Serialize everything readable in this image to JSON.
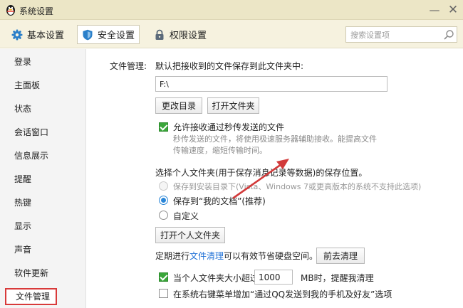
{
  "window": {
    "title": "系统设置",
    "minimize_glyph": "—",
    "close_glyph": "✕"
  },
  "tabs": [
    {
      "label": "基本设置",
      "icon": "gear-icon"
    },
    {
      "label": "安全设置",
      "icon": "shield-icon"
    },
    {
      "label": "权限设置",
      "icon": "lock-icon"
    }
  ],
  "search": {
    "placeholder": "搜索设置项"
  },
  "sidebar": {
    "items": [
      {
        "label": "登录"
      },
      {
        "label": "主面板"
      },
      {
        "label": "状态"
      },
      {
        "label": "会话窗口"
      },
      {
        "label": "信息展示"
      },
      {
        "label": "提醒"
      },
      {
        "label": "热键"
      },
      {
        "label": "显示"
      },
      {
        "label": "声音"
      },
      {
        "label": "软件更新"
      },
      {
        "label": "文件管理"
      }
    ],
    "active": "文件管理"
  },
  "file_manage": {
    "section_label": "文件管理:",
    "desc": "默认把接收到的文件保存到此文件夹中:",
    "path_value": "F:\\",
    "change_dir_button": "更改目录",
    "open_folder_button": "打开文件夹",
    "instant_transfer": {
      "label": "允许接收通过秒传发送的文件",
      "checked": true,
      "hint": "秒传发送的文件，将使用极速服务器辅助接收。能提高文件传输速度，缩短传输时间。"
    },
    "personal_folder": {
      "label": "选择个人文件夹(用于保存消息记录等数据)的保存位置。",
      "options": [
        {
          "label": "保存到安装目录下(Vista、Windows 7或更高版本的系统不支持此选项)",
          "disabled": true,
          "selected": false
        },
        {
          "label": "保存到“我的文档”(推荐)",
          "disabled": false,
          "selected": true
        },
        {
          "label": "自定义",
          "disabled": false,
          "selected": false
        }
      ],
      "open_button": "打开个人文件夹"
    },
    "cleanup": {
      "prefix": "定期进行",
      "link": "文件清理",
      "suffix": "可以有效节省硬盘空间。",
      "button": "前去清理"
    },
    "size_reminder": {
      "label_before": "当个人文件夹大小超过",
      "value": "1000",
      "label_after": "MB时，提醒我清理",
      "checked": true
    },
    "context_menu": {
      "label": "在系统右键菜单增加“通过QQ发送到我的手机及好友”选项",
      "checked": false
    }
  },
  "colors": {
    "titlebar_bg": "#ece6c6",
    "tabbar_bg": "#f6f2df",
    "accent_blue": "#2a86d8",
    "check_green": "#3aa63a",
    "highlight_red": "#d83a3a"
  }
}
